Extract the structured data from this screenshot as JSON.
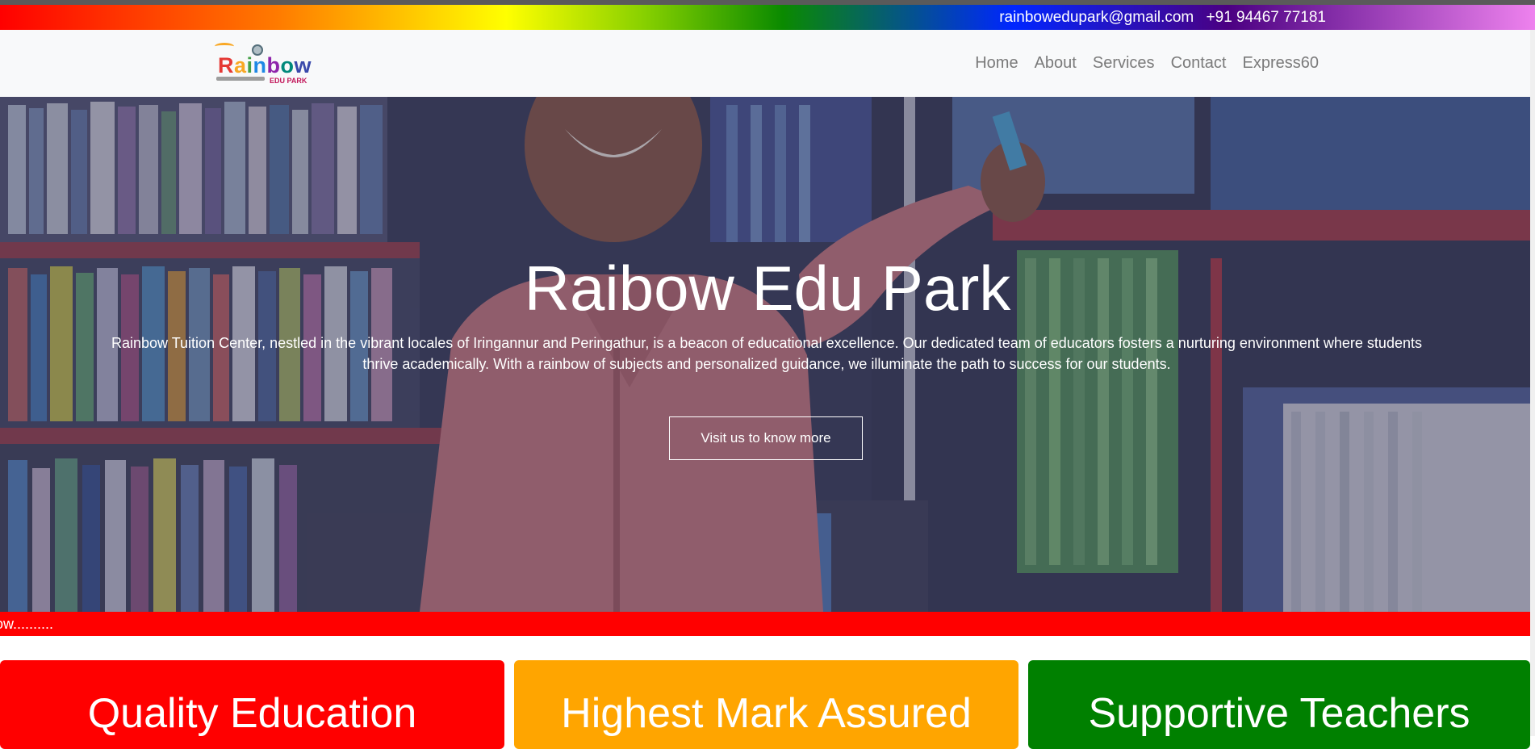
{
  "topbar": {
    "email": "rainbowedupark@gmail.com",
    "phone": "+91 94467 77181"
  },
  "logo": {
    "letters": [
      "R",
      "a",
      "i",
      "n",
      "b",
      "o",
      "w"
    ],
    "subtitle": "EDU PARK"
  },
  "nav": {
    "items": [
      {
        "label": "Home"
      },
      {
        "label": "About"
      },
      {
        "label": "Services"
      },
      {
        "label": "Contact"
      },
      {
        "label": "Express60"
      }
    ]
  },
  "hero": {
    "title": "Raibow Edu Park",
    "description": "Rainbow Tuition Center, nestled in the vibrant locales of Iringannur and Peringathur, is a beacon of educational excellence. Our dedicated team of educators fosters a nurturing environment where students thrive academically. With a rainbow of subjects and personalized guidance, we illuminate the path to success for our students.",
    "button_label": "Visit us to know more"
  },
  "ticker": {
    "text": "ow.........."
  },
  "cards": [
    {
      "title": "Quality Education",
      "color": "#ff0000"
    },
    {
      "title": "Highest Mark Assured",
      "color": "#ffa500"
    },
    {
      "title": "Supportive Teachers",
      "color": "#008000"
    }
  ],
  "colors": {
    "nav_bg": "#f8f9fa",
    "nav_text": "#7a7a7a",
    "ticker_bg": "#ff0000"
  }
}
